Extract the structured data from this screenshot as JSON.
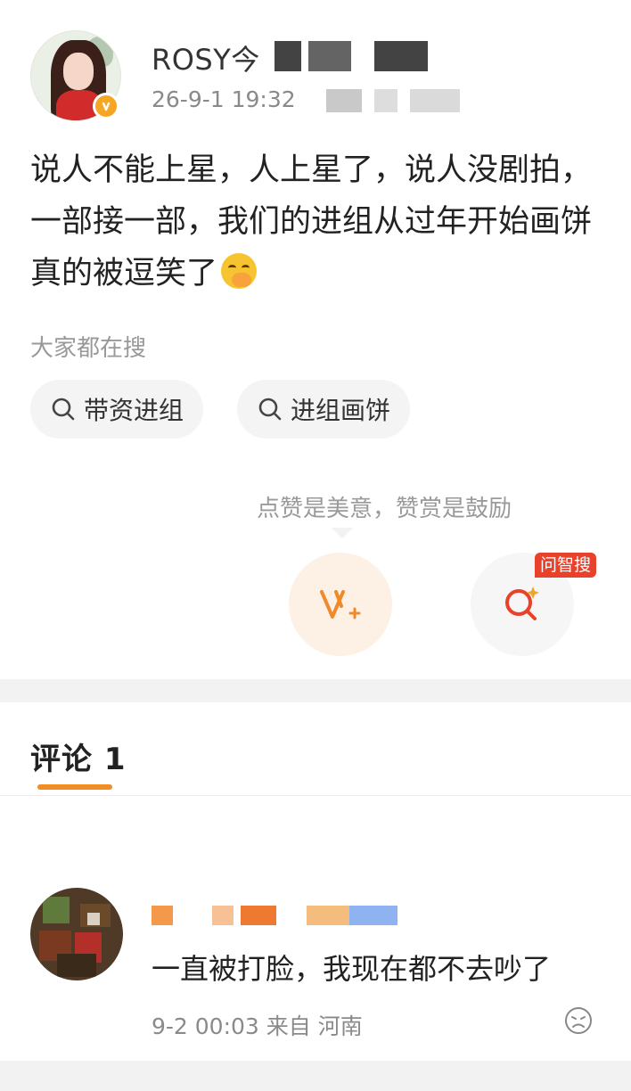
{
  "post": {
    "username": "ROSY今",
    "timestamp": "26-9-1 19:32",
    "body_lines": [
      "说人不能上星，人上星了，说人没剧拍，",
      "一部接一部，我们的进组从过年开始画饼",
      "真的被逗笑了"
    ],
    "emoji_icon": "face-with-hand-over-mouth-emoji",
    "search_label": "大家都在搜",
    "search_chips": [
      "带资进组",
      "进组画饼"
    ],
    "reward_hint": "点赞是美意，赞赏是鼓励",
    "ask_badge": "问智搜",
    "accent_color": "#f08d23",
    "badge_color": "#e8412c"
  },
  "comments": {
    "title": "评论 1",
    "items": [
      {
        "text": "一直被打脸，我现在都不去吵了",
        "meta": "9-2 00:03 来自 河南"
      }
    ]
  }
}
